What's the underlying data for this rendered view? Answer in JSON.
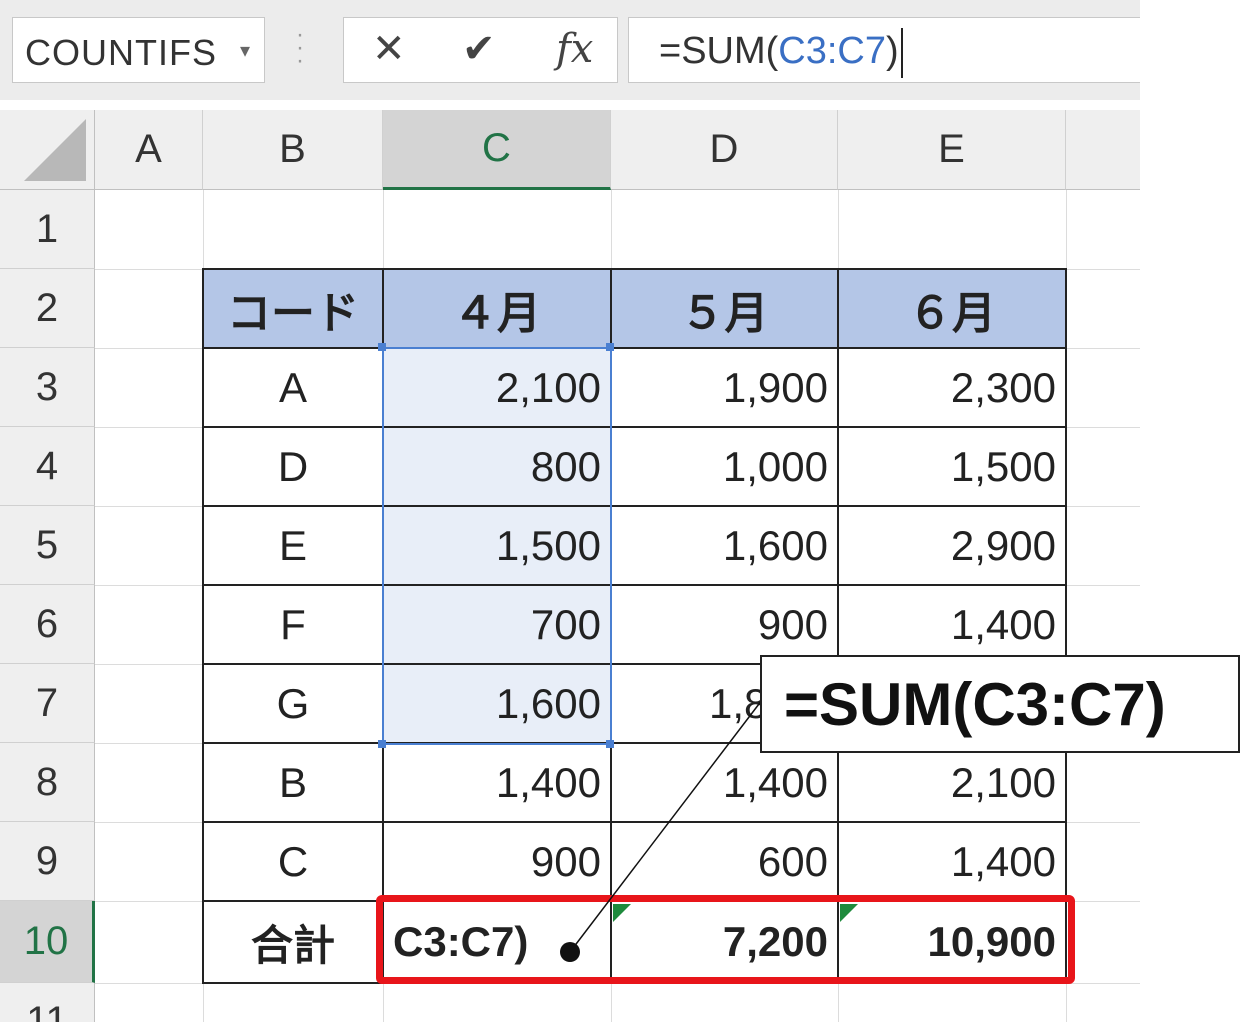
{
  "formula_bar": {
    "name_box": "COUNTIFS",
    "formula_prefix": "=SUM(",
    "formula_ref": "C3:C7",
    "formula_suffix": ")",
    "cancel_icon": "✕",
    "enter_icon": "✔",
    "fx_icon": "fx"
  },
  "columns": [
    "A",
    "B",
    "C",
    "D",
    "E"
  ],
  "rows": [
    "1",
    "2",
    "3",
    "4",
    "5",
    "6",
    "7",
    "8",
    "9",
    "10",
    "11"
  ],
  "table": {
    "headers": [
      "コード",
      "４月",
      "５月",
      "６月"
    ],
    "rows": [
      [
        "A",
        "2,100",
        "1,900",
        "2,300"
      ],
      [
        "D",
        "800",
        "1,000",
        "1,500"
      ],
      [
        "E",
        "1,500",
        "1,600",
        "2,900"
      ],
      [
        "F",
        "700",
        "900",
        "1,400"
      ],
      [
        "G",
        "1,600",
        "1,8",
        ""
      ],
      [
        "B",
        "1,400",
        "1,400",
        "2,100"
      ],
      [
        "C",
        "900",
        "600",
        "1,400"
      ]
    ],
    "total_row": [
      "合計",
      "C3:C7)",
      "7,200",
      "10,900"
    ]
  },
  "callout": {
    "text": "=SUM(C3:C7)"
  },
  "colors": {
    "header_fill": "#b4c6e7",
    "selection": "#4a7fd1",
    "highlight": "#e8151a",
    "excel_green": "#217346"
  }
}
